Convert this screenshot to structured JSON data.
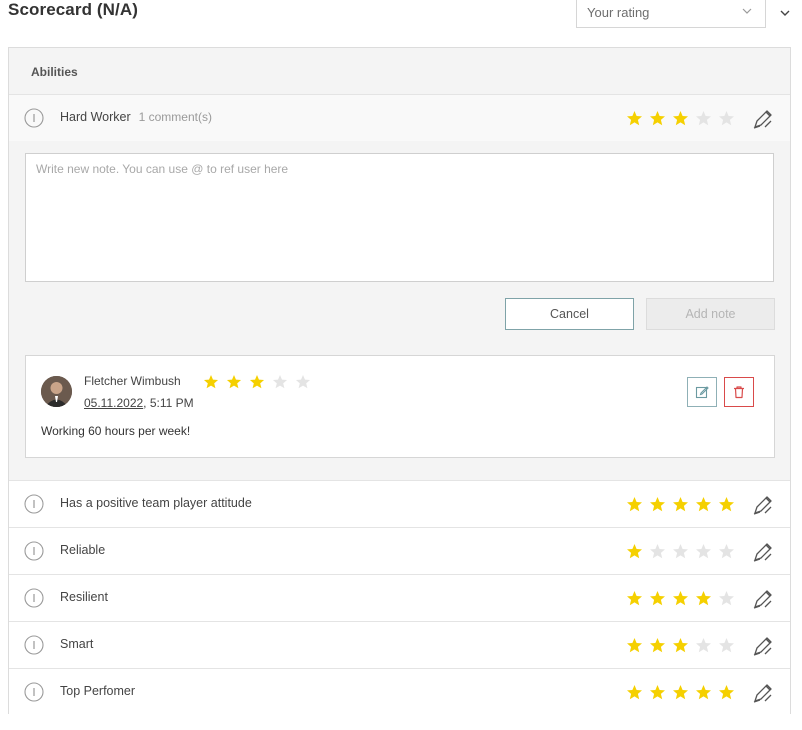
{
  "header": {
    "title": "Scorecard (N/A)",
    "rating_placeholder": "Your rating"
  },
  "section": {
    "title": "Abilities"
  },
  "abilities": [
    {
      "label": "Hard Worker",
      "comments": "1 comment(s)",
      "rating": 3,
      "max": 5
    },
    {
      "label": "Has a positive team player attitude",
      "comments": "",
      "rating": 5,
      "max": 5
    },
    {
      "label": "Reliable",
      "comments": "",
      "rating": 1,
      "max": 5
    },
    {
      "label": "Resilient",
      "comments": "",
      "rating": 4,
      "max": 5
    },
    {
      "label": "Smart",
      "comments": "",
      "rating": 3,
      "max": 5
    },
    {
      "label": "Top Perfomer",
      "comments": "",
      "rating": 5,
      "max": 5
    }
  ],
  "note": {
    "placeholder": "Write new note. You can use @ to ref user here",
    "value": "",
    "cancel_label": "Cancel",
    "add_label": "Add note"
  },
  "comment": {
    "author": "Fletcher Wimbush",
    "date": "05.11.2022",
    "time": ", 5:11 PM",
    "text": "Working 60 hours per week!",
    "rating": 3,
    "max": 5
  },
  "icons": {
    "info": "info-circle-icon",
    "edit_rating": "pen-edit-icon",
    "chevron": "chevron-down-icon",
    "edit_comment": "edit-square-icon",
    "delete_comment": "trash-icon"
  },
  "colors": {
    "star_filled": "#f5d000",
    "star_empty": "#e4e4e4",
    "delete_red": "#d94a4a",
    "edit_teal": "#6b9aa1"
  }
}
